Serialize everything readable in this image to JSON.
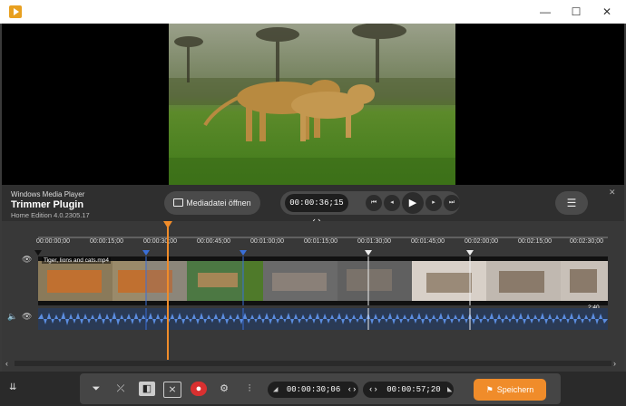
{
  "window": {
    "minimize": "—",
    "maximize": "☐",
    "close": "✕"
  },
  "info": {
    "app": "Windows Media Player",
    "plugin": "Trimmer Plugin",
    "edition": "Home Edition 4.0.2305.17"
  },
  "toolbar": {
    "open_file": "Mediadatei öffnen",
    "current_time": "00:00:36;15",
    "menu": "☰"
  },
  "ruler": {
    "ticks": [
      "00:00:00;00",
      "00:00:15;00",
      "00:00:30;00",
      "00:00:45;00",
      "00:01:00;00",
      "00:01:15;00",
      "00:01:30;00",
      "00:01:45;00",
      "00:02:00;00",
      "00:02:15;00",
      "00:02:30;00"
    ]
  },
  "track": {
    "clip_name": "Tiger, lions and cats.mp4",
    "duration": "2:40"
  },
  "bottom": {
    "start_time": "00:00:30;06",
    "end_time": "00:00:57;20",
    "save_label": "Speichern"
  },
  "colors": {
    "accent": "#f08c2a",
    "marker_blue": "#3a6fd8",
    "waveform": "#5b8de0",
    "record": "#d93030"
  }
}
